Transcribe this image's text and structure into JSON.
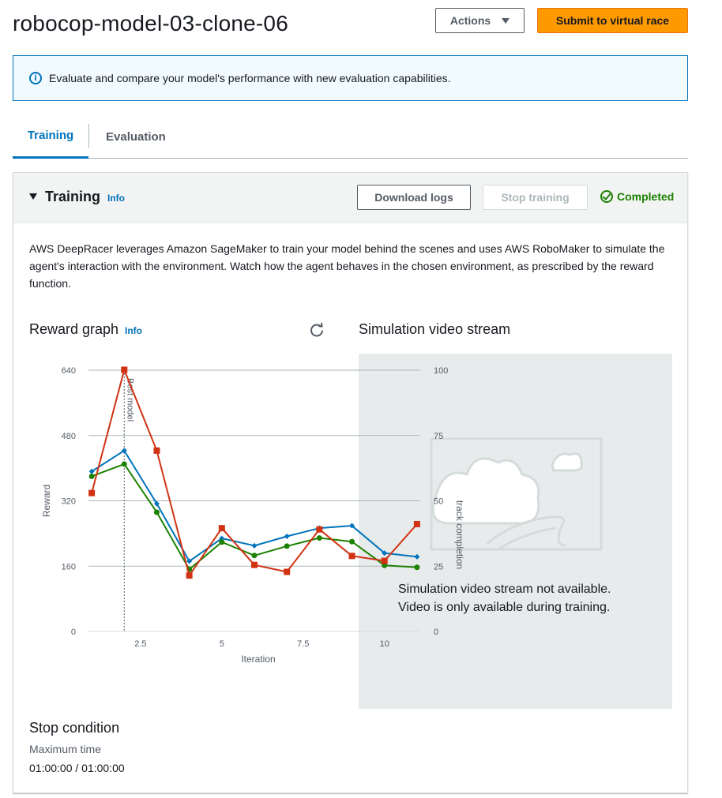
{
  "header": {
    "title": "robocop-model-03-clone-06",
    "actions_label": "Actions",
    "submit_label": "Submit to virtual race"
  },
  "banner": {
    "text": "Evaluate and compare your model's performance with new evaluation capabilities."
  },
  "tabs": [
    {
      "label": "Training",
      "active": true
    },
    {
      "label": "Evaluation",
      "active": false
    }
  ],
  "training_panel": {
    "title": "Training",
    "info_label": "Info",
    "download_logs_label": "Download logs",
    "stop_training_label": "Stop training",
    "status": "Completed",
    "description": "AWS DeepRacer leverages Amazon SageMaker to train your model behind the scenes and uses AWS RoboMaker to simulate the agent's interaction with the environment. Watch how the agent behaves in the chosen environment, as prescribed by the reward function."
  },
  "reward_graph": {
    "title": "Reward graph",
    "info_label": "Info"
  },
  "simulation": {
    "title": "Simulation video stream",
    "message_line1": "Simulation video stream not available.",
    "message_line2": "Video is only available during training."
  },
  "stop_condition": {
    "title": "Stop condition",
    "label": "Maximum time",
    "value": "01:00:00 / 01:00:00"
  },
  "colors": {
    "accent": "#0073bb",
    "submit": "#ff9900",
    "completed": "#1d8102",
    "series_blue": "#0073bb",
    "series_green": "#1d8102",
    "series_red": "#d13212"
  },
  "chart_data": {
    "type": "line",
    "xlabel": "Iteration",
    "ylabel": "Reward",
    "y2label": "track completion",
    "x_ticks": [
      "2.5",
      "5",
      "7.5",
      "10"
    ],
    "y_ticks": [
      "640",
      "480",
      "320",
      "160",
      "0"
    ],
    "y2_ticks": [
      "100",
      "75",
      "50",
      "25",
      "0"
    ],
    "xlim": [
      0.9,
      11.1
    ],
    "ylim": [
      0,
      640
    ],
    "y2lim": [
      0,
      100
    ],
    "marker_label": "Best model",
    "marker_x": 2,
    "x": [
      1,
      2,
      3,
      4,
      5,
      6,
      7,
      8,
      9,
      10,
      11
    ],
    "series": [
      {
        "color": "#0073bb",
        "marker": "diamond",
        "values": [
          392,
          443,
          313,
          172,
          228,
          210,
          233,
          253,
          259,
          192,
          183
        ]
      },
      {
        "color": "#1d8102",
        "marker": "circle",
        "values": [
          380,
          410,
          292,
          152,
          219,
          186,
          209,
          229,
          220,
          162,
          157
        ]
      },
      {
        "color": "#d13212",
        "marker": "square",
        "values": [
          339,
          641,
          443,
          137,
          253,
          163,
          146,
          250,
          185,
          173,
          263
        ]
      }
    ]
  }
}
